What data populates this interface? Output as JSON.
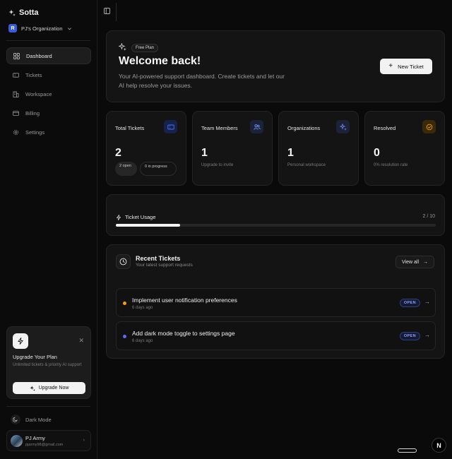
{
  "app": {
    "name": "Sotta"
  },
  "organization": {
    "name": "PJ's Organization",
    "initial": "R"
  },
  "nav": {
    "items": [
      {
        "label": "Dashboard",
        "icon": "dashboard-icon",
        "active": true
      },
      {
        "label": "Tickets",
        "icon": "ticket-icon"
      },
      {
        "label": "Workspace",
        "icon": "building-icon"
      },
      {
        "label": "Billing",
        "icon": "credit-card-icon"
      },
      {
        "label": "Settings",
        "icon": "gear-icon"
      }
    ]
  },
  "upgrade": {
    "title": "Upgrade Your Plan",
    "description": "Unlimited tickets & priority AI support",
    "button": "Upgrade Now"
  },
  "theme_toggle": {
    "label": "Dark Mode"
  },
  "user": {
    "name": "PJ Army",
    "email": "pjarmy98@gmail.com"
  },
  "hero": {
    "plan_badge": "Free Plan",
    "title": "Welcome back!",
    "description": "Your AI-powered support dashboard. Create tickets and let our AI help resolve your issues.",
    "new_ticket": "New Ticket"
  },
  "stats": {
    "total_tickets": {
      "label": "Total Tickets",
      "value": "2",
      "open_pill": "2 open",
      "progress_pill": "0 in progress",
      "icon_color": "#3b5bdb"
    },
    "team_members": {
      "label": "Team Members",
      "value": "1",
      "sub": "Upgrade to invite",
      "icon_color": "#6b8cff"
    },
    "organizations": {
      "label": "Organizations",
      "value": "1",
      "sub": "Personal workspace",
      "icon_color": "#6b8cff"
    },
    "resolved": {
      "label": "Resolved",
      "value": "0",
      "sub": "0% resolution rate",
      "icon_color": "#f59f00"
    }
  },
  "usage": {
    "label": "Ticket Usage",
    "count": "2 / 10",
    "used": 2,
    "limit": 10
  },
  "recent": {
    "title": "Recent Tickets",
    "subtitle": "Your latest support requests",
    "view_all": "View all",
    "tickets": [
      {
        "title": "Implement user notification preferences",
        "time": "6 days ago",
        "status": "OPEN",
        "dot_color": "#f59f00"
      },
      {
        "title": "Add dark mode toggle to settings page",
        "time": "6 days ago",
        "status": "OPEN",
        "dot_color": "#5c6cff"
      }
    ]
  },
  "dev_badge": {
    "letter": "N"
  }
}
